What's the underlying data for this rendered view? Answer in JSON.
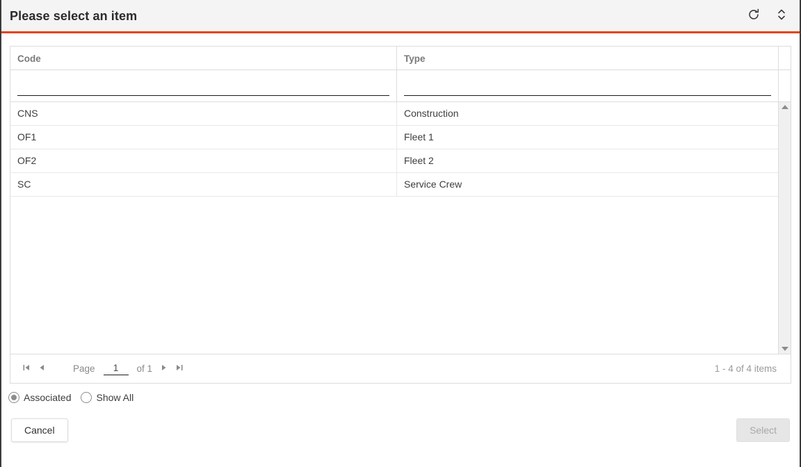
{
  "dialog": {
    "title": "Please select an item",
    "accent_color": "#e8430f",
    "actions": [
      {
        "name": "refresh-icon",
        "label": "Refresh"
      },
      {
        "name": "resize-icon",
        "label": "Resize"
      }
    ]
  },
  "grid": {
    "columns": [
      {
        "key": "code",
        "header": "Code",
        "filter_value": "",
        "filter_placeholder": ""
      },
      {
        "key": "type",
        "header": "Type",
        "filter_value": "",
        "filter_placeholder": ""
      }
    ],
    "rows": [
      {
        "code": "CNS",
        "type": "Construction"
      },
      {
        "code": "OF1",
        "type": "Fleet 1"
      },
      {
        "code": "OF2",
        "type": "Fleet 2"
      },
      {
        "code": "SC",
        "type": "Service Crew"
      }
    ],
    "scrollbar": {
      "up_arrow": "▲",
      "down_arrow": "▼"
    }
  },
  "pager": {
    "first_label": "⏮",
    "prev_label": "◀",
    "page_label": "Page",
    "page_value": "1",
    "of_label": "of 1",
    "next_label": "▶",
    "last_label": "⏭",
    "item_count": "1 - 4 of 4 items"
  },
  "filter_options": [
    {
      "label": "Associated",
      "selected": true
    },
    {
      "label": "Show All",
      "selected": false
    }
  ],
  "footer": {
    "cancel_label": "Cancel",
    "select_label": "Select",
    "select_disabled": true
  }
}
